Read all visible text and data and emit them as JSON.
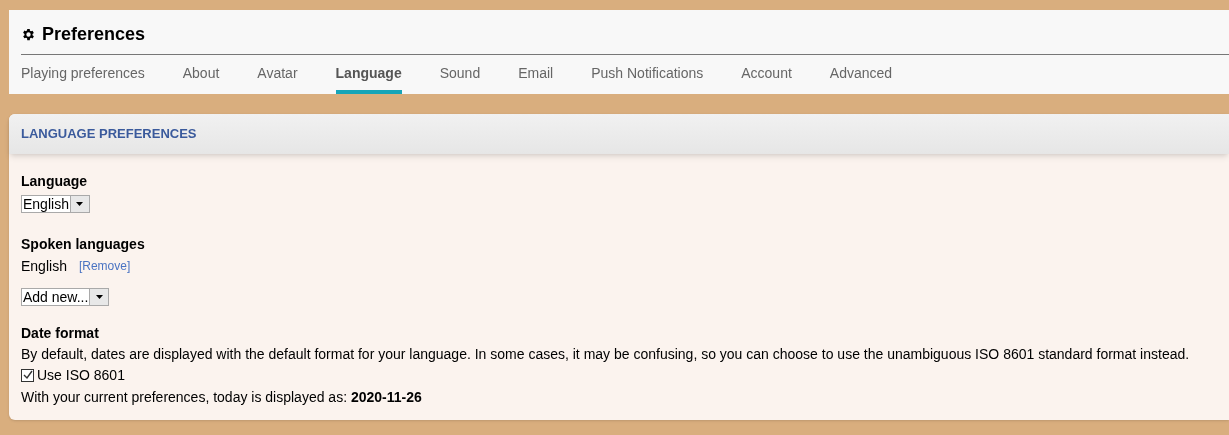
{
  "header": {
    "title": "Preferences"
  },
  "tabs": [
    {
      "label": "Playing preferences",
      "selected": false
    },
    {
      "label": "About",
      "selected": false
    },
    {
      "label": "Avatar",
      "selected": false
    },
    {
      "label": "Language",
      "selected": true
    },
    {
      "label": "Sound",
      "selected": false
    },
    {
      "label": "Email",
      "selected": false
    },
    {
      "label": "Push Notifications",
      "selected": false
    },
    {
      "label": "Account",
      "selected": false
    },
    {
      "label": "Advanced",
      "selected": false
    }
  ],
  "section": {
    "title": "LANGUAGE PREFERENCES",
    "language": {
      "label": "Language",
      "value": "English"
    },
    "spoken": {
      "label": "Spoken languages",
      "items": [
        {
          "name": "English",
          "action": "[Remove]"
        }
      ],
      "add_value": "Add new..."
    },
    "date_format": {
      "label": "Date format",
      "description": "By default, dates are displayed with the default format for your language. In some cases, it may be confusing, so you can choose to use the unambiguous ISO 8601 standard format instead.",
      "checkbox": {
        "label": "Use ISO 8601",
        "checked": true
      },
      "preview": "With your current preferences, today is displayed as: **2020-11-26**"
    }
  }
}
